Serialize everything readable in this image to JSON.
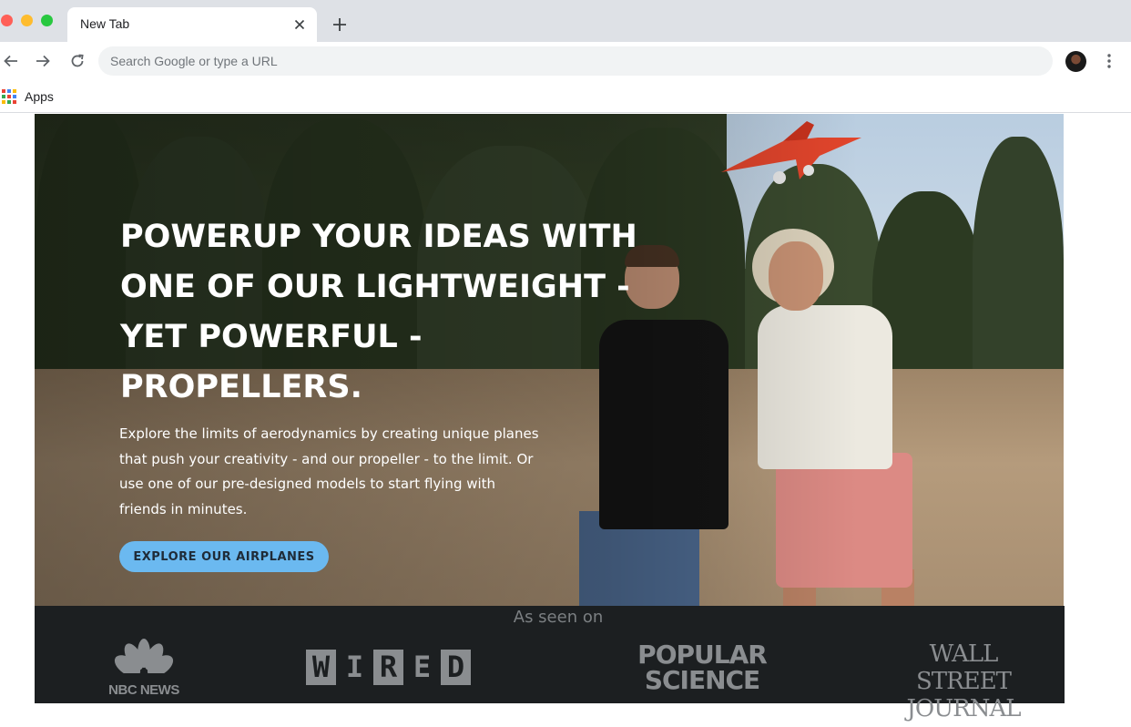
{
  "browser": {
    "tab_title": "New Tab",
    "omnibox_placeholder": "Search Google or type a URL",
    "bookmarks": [
      {
        "label": "Apps",
        "icon": "apps-grid-icon"
      }
    ]
  },
  "hero": {
    "headline": "POWERUP YOUR IDEAS WITH\nONE OF OUR LIGHTWEIGHT -\nYET POWERFUL -\nPROPELLERS.",
    "subtext": "Explore the limits of aerodynamics by creating unique planes\nthat push your creativity - and our propeller - to the limit. Or\nuse one of our pre-designed models to start flying with\nfriends in minutes.",
    "cta_label": "EXPLORE OUR AIRPLANES",
    "cta_color": "#6bb9f0"
  },
  "press": {
    "title": "As seen on",
    "logos": {
      "nbc": "NBC NEWS",
      "wired_letters": [
        "W",
        "I",
        "R",
        "E",
        "D"
      ],
      "popsci": "POPULAR\nSCIENCE",
      "wsj": "WALL STREET\nJOURNAL"
    }
  },
  "colors": {
    "accent": "#6bb9f0",
    "press_bg": "#1c1f21"
  }
}
